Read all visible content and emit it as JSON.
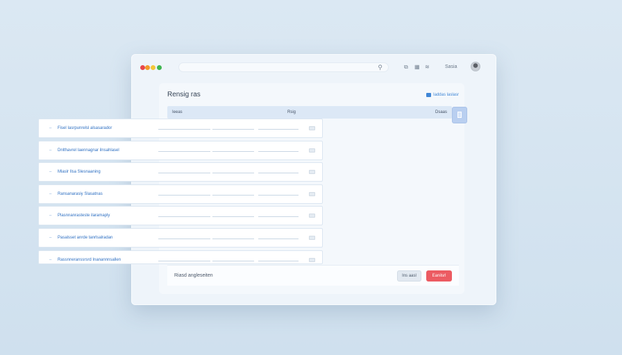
{
  "window": {
    "traffic_lights": [
      "#e8474a",
      "#f29b2b",
      "#f2c63a",
      "#3fb651"
    ],
    "search": {
      "value": "",
      "icon": "search-icon"
    },
    "toolbar_icons": [
      "copy-icon",
      "grid-icon",
      "settings-icon"
    ],
    "user_name": "Sasia",
    "avatar": "avatar"
  },
  "panel": {
    "title": "Rensig ras",
    "action_label": "Iaddas laslasr",
    "columns": [
      "Ieeas",
      "Rsig",
      "Dsaas"
    ],
    "side_button_icon": "document-icon",
    "rows": [
      {
        "name": "Fisel Iasrpunrelsl alsasarador",
        "tag": "tag"
      },
      {
        "name": "Dnlthavrel Iaennagnar ilnsahlasel",
        "tag": "tag"
      },
      {
        "name": "Mlaslr Ilsa Slesnaaning",
        "tag": "tag"
      },
      {
        "name": "Ransanarasiy Slasatnas",
        "tag": "tag"
      },
      {
        "name": "Plasnnanrasteste ilaramaply",
        "tag": "tag"
      },
      {
        "name": "Pasalsset anrde tanrlsalradan",
        "tag": "tag"
      },
      {
        "name": "Rassnneranssrsrd Inanannnsallen",
        "tag": "tag"
      }
    ]
  },
  "footer": {
    "status": "Riasd angleseiten",
    "cancel_label": "Ins aasl",
    "confirm_label": "Eanilsrl",
    "confirm_color": "#ec5b62"
  }
}
